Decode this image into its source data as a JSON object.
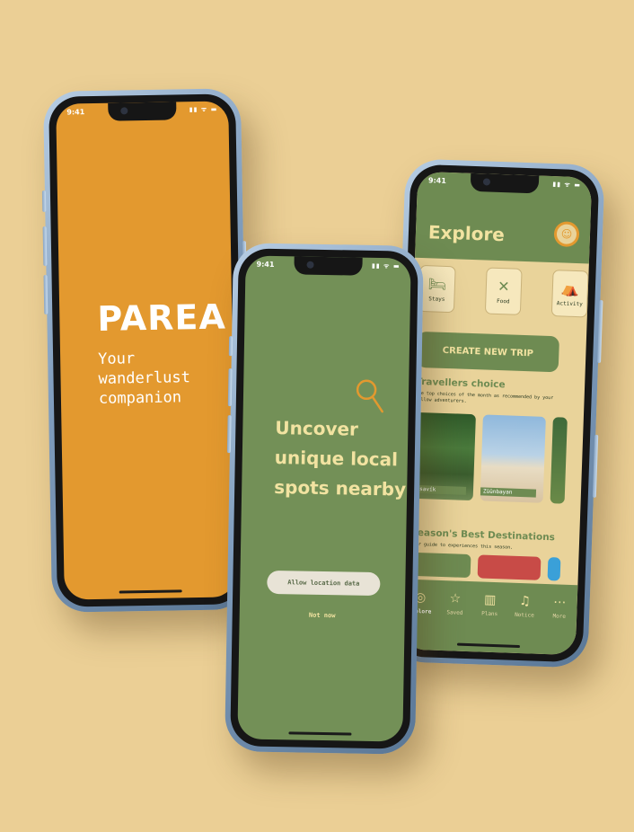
{
  "status": {
    "time": "9:41",
    "icons": "▮▮ ᯤ ▬"
  },
  "splash": {
    "brand": "PAREA",
    "tagline": "Your wanderlust companion"
  },
  "location": {
    "headline": "Uncover unique local spots nearby",
    "allow_button": "Allow location data",
    "skip_link": "Not now"
  },
  "explore": {
    "title": "Explore",
    "avatar_icon": "smiley-icon",
    "categories": [
      {
        "label": "Stays",
        "icon": "bed-icon"
      },
      {
        "label": "Food",
        "icon": "utensils-icon"
      },
      {
        "label": "Activity",
        "icon": "tent-icon"
      }
    ],
    "create_button": "CREATE NEW TRIP",
    "travellers_choice": {
      "title": "Travellers choice",
      "subtitle": "The top choices of the month as recommended by your fellow adventurers.",
      "cards": [
        {
          "label": "Húsavík"
        },
        {
          "label": "Züünbayan"
        }
      ]
    },
    "season": {
      "title": "Season's Best Destinations",
      "subtitle": "Your guide to experiences this season."
    },
    "tabs": [
      {
        "label": "Explore",
        "icon": "compass-icon",
        "active": true
      },
      {
        "label": "Saved",
        "icon": "star-icon",
        "active": false
      },
      {
        "label": "Plans",
        "icon": "trash-icon",
        "active": false
      },
      {
        "label": "Notice",
        "icon": "bell-icon",
        "active": false
      },
      {
        "label": "More",
        "icon": "ellipsis-icon",
        "active": false
      }
    ]
  },
  "colors": {
    "background": "#ebcf95",
    "orange": "#e3992f",
    "green": "#6e8b52",
    "cream": "#f2e3a1"
  }
}
